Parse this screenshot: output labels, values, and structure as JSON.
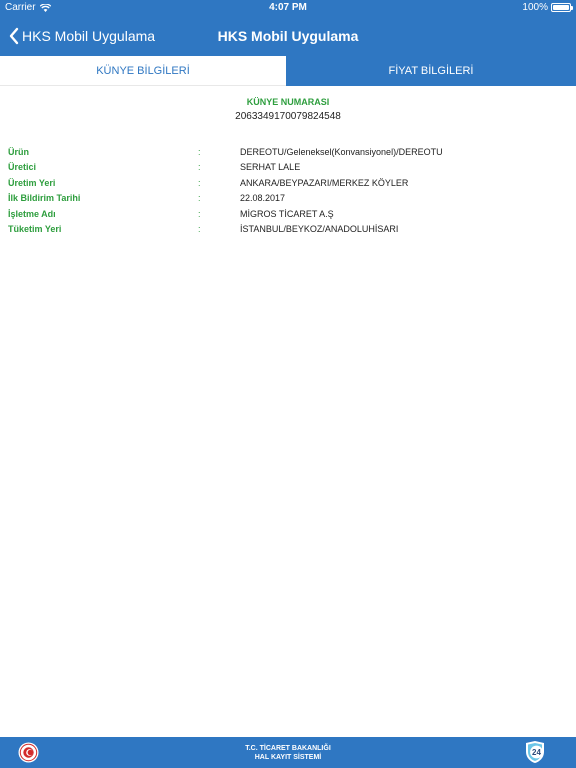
{
  "status_bar": {
    "carrier": "Carrier",
    "time": "4:07 PM",
    "battery": "100%"
  },
  "nav": {
    "back_label": "HKS Mobil Uygulama",
    "title": "HKS Mobil Uygulama"
  },
  "tabs": [
    {
      "label": "KÜNYE BİLGİLERİ",
      "selected": true
    },
    {
      "label": "FİYAT BİLGİLERİ",
      "selected": false
    }
  ],
  "kunye": {
    "label": "KÜNYE NUMARASI",
    "number": "2063349170079824548"
  },
  "info": [
    {
      "label": "Ürün",
      "colon": ":",
      "value": "DEREOTU/Geleneksel(Konvansiyonel)/DEREOTU"
    },
    {
      "label": "Üretici",
      "colon": ":",
      "value": "SERHAT LALE"
    },
    {
      "label": "Üretim Yeri",
      "colon": ":",
      "value": "ANKARA/BEYPAZARI/MERKEZ KÖYLER"
    },
    {
      "label": "İlk Bildirim Tarihi",
      "colon": ":",
      "value": "22.08.2017"
    },
    {
      "label": "İşletme Adı",
      "colon": ":",
      "value": "MİGROS TİCARET A.Ş"
    },
    {
      "label": "Tüketim Yeri",
      "colon": ":",
      "value": "İSTANBUL/BEYKOZ/ANADOLUHİSARI"
    }
  ],
  "footer": {
    "line1": "T.C. TİCARET BAKANLIĞI",
    "line2": "HAL KAYIT SİSTEMİ",
    "badge": "24"
  },
  "colors": {
    "primary_blue": "#2f77c2",
    "label_green": "#2e9e3e"
  }
}
